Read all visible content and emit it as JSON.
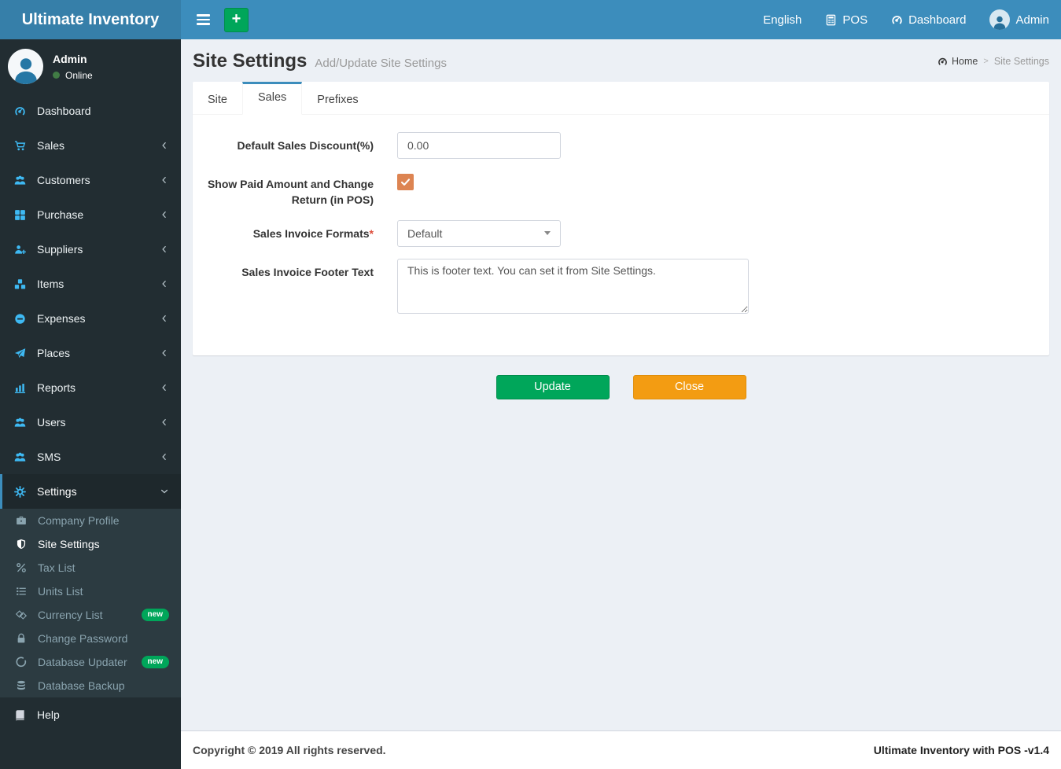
{
  "header": {
    "brand": "Ultimate Inventory",
    "nav": {
      "language": "English",
      "pos": "POS",
      "dashboard": "Dashboard",
      "user": "Admin"
    }
  },
  "user_panel": {
    "name": "Admin",
    "status": "Online"
  },
  "sidebar": {
    "items": [
      {
        "label": "Dashboard"
      },
      {
        "label": "Sales"
      },
      {
        "label": "Customers"
      },
      {
        "label": "Purchase"
      },
      {
        "label": "Suppliers"
      },
      {
        "label": "Items"
      },
      {
        "label": "Expenses"
      },
      {
        "label": "Places"
      },
      {
        "label": "Reports"
      },
      {
        "label": "Users"
      },
      {
        "label": "SMS"
      },
      {
        "label": "Settings"
      }
    ],
    "settings_submenu": [
      {
        "label": "Company Profile"
      },
      {
        "label": "Site Settings"
      },
      {
        "label": "Tax List"
      },
      {
        "label": "Units List"
      },
      {
        "label": "Currency List",
        "badge": "new"
      },
      {
        "label": "Change Password"
      },
      {
        "label": "Database Updater",
        "badge": "new"
      },
      {
        "label": "Database Backup"
      }
    ],
    "help_label": "Help"
  },
  "page": {
    "title": "Site Settings",
    "subtitle": "Add/Update Site Settings",
    "breadcrumb": {
      "home": "Home",
      "separator": ">",
      "current": "Site Settings"
    },
    "tabs": [
      {
        "label": "Site"
      },
      {
        "label": "Sales"
      },
      {
        "label": "Prefixes"
      }
    ],
    "form": {
      "discount_label": "Default Sales Discount(%)",
      "discount_value": "0.00",
      "paid_amount_label": "Show Paid Amount and Change Return (in POS)",
      "invoice_format_label": "Sales Invoice Formats",
      "required_mark": "*",
      "invoice_format_value": "Default",
      "footer_text_label": "Sales Invoice Footer Text",
      "footer_text_value": "This is footer text. You can set it from Site Settings."
    },
    "buttons": {
      "update": "Update",
      "close": "Close"
    }
  },
  "footer": {
    "copyright": "Copyright © 2019 All rights reserved.",
    "version": "Ultimate Inventory with POS -v1.4"
  },
  "colors": {
    "navbar": "#3c8dbc",
    "logo_bg": "#367fa9",
    "sidebar_bg": "#222d32",
    "submenu_bg": "#2c3b41",
    "icon_blue": "#3eb9f3",
    "green": "#00a65a",
    "orange_btn": "#f39c12",
    "checkbox_orange": "#dd8452",
    "content_bg": "#ecf0f5"
  }
}
